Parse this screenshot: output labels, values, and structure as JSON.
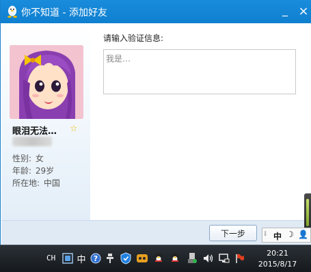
{
  "window": {
    "title": "你不知道 - 添加好友",
    "minimize_label": "_",
    "close_label": "×"
  },
  "profile": {
    "nickname": "眼泪无法…",
    "gender_label": "性别:",
    "gender_value": "女",
    "age_label": "年龄:",
    "age_value": "29岁",
    "location_label": "所在地:",
    "location_value": "中国"
  },
  "form": {
    "prompt": "请输入验证信息:",
    "message_placeholder": "我是…",
    "next_button": "下一步"
  },
  "ime": {
    "mode": "中",
    "grip": "⁞⁞",
    "moon": "☽",
    "user": "👤"
  },
  "taskbar": {
    "language": "CH",
    "ime_indicator": "中",
    "help": "?",
    "clock_time": "20:21",
    "clock_date": "2015/8/17"
  },
  "colors": {
    "titlebar": "#1a8cdc",
    "bottom_bar": "#dfeaf5",
    "star": "#f5b800"
  },
  "icons": [
    "qq-penguin-icon",
    "star-icon",
    "shield-icon",
    "volume-icon",
    "network-icon",
    "flag-icon"
  ]
}
